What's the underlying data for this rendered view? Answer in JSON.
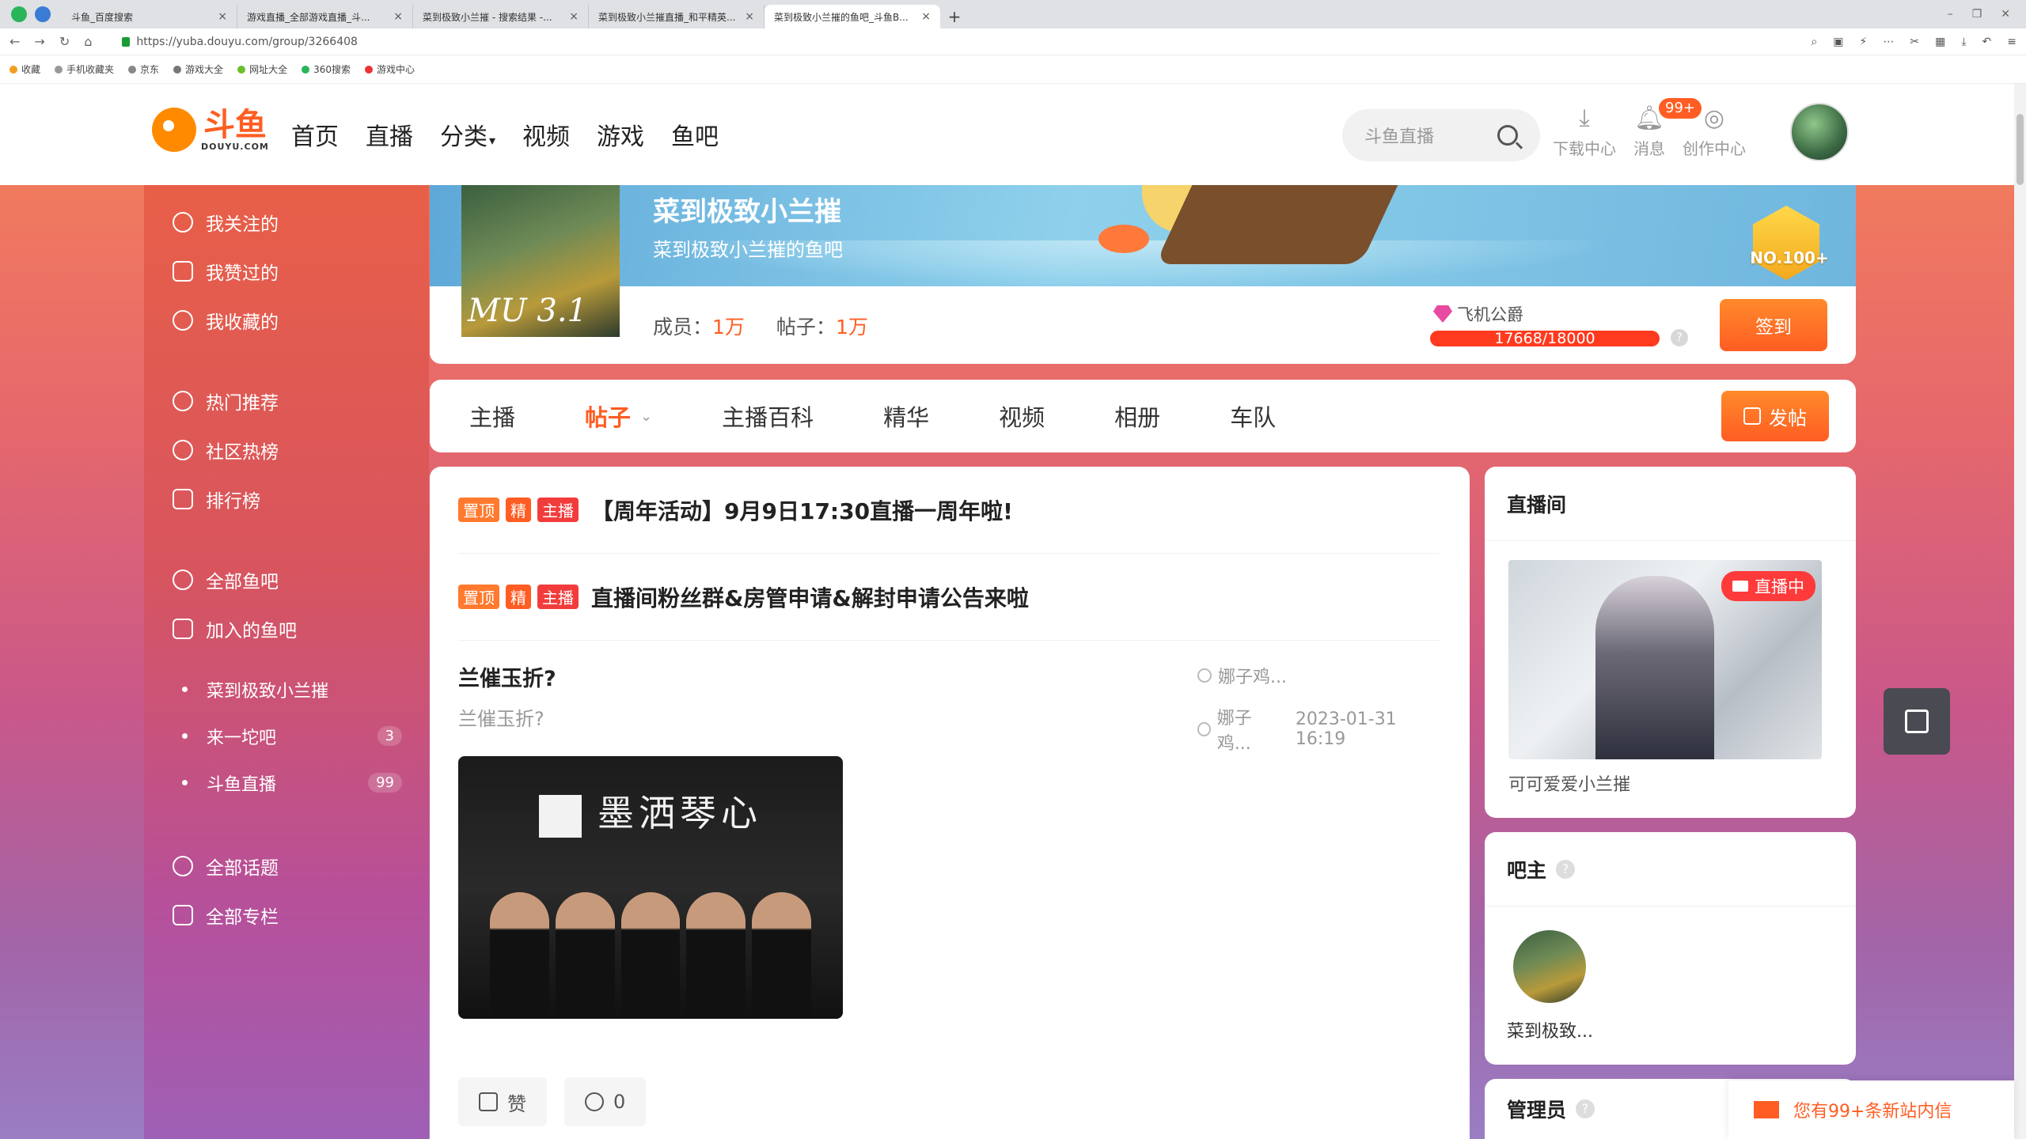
{
  "browser": {
    "tabs": [
      {
        "title": "斗鱼_百度搜索",
        "active": false
      },
      {
        "title": "游戏直播_全部游戏直播_斗...",
        "active": false
      },
      {
        "title": "菜到极致小兰摧 - 搜索结果 -...",
        "active": false
      },
      {
        "title": "菜到极致小兰摧直播_和平精英...",
        "active": false
      },
      {
        "title": "菜到极致小兰摧的鱼吧_斗鱼B...",
        "active": true
      }
    ],
    "new_tab": "+",
    "url": "https://yuba.douyu.com/group/3266408",
    "bookmarks": [
      "收藏",
      "手机收藏夹",
      "京东",
      "游戏大全",
      "网址大全",
      "360搜索",
      "游戏中心"
    ]
  },
  "header": {
    "logo_cn": "斗鱼",
    "logo_en": "DOUYU.COM",
    "nav": [
      "首页",
      "直播",
      "分类",
      "视频",
      "游戏",
      "鱼吧"
    ],
    "search_placeholder": "斗鱼直播",
    "download_label": "下载中心",
    "messages_label": "消息",
    "messages_badge": "99+",
    "creator_label": "创作中心"
  },
  "sidebar": {
    "group1": [
      "我关注的",
      "我赞过的",
      "我收藏的"
    ],
    "group2": [
      "热门推荐",
      "社区热榜",
      "排行榜"
    ],
    "group3": [
      "全部鱼吧",
      "加入的鱼吧"
    ],
    "joined": [
      {
        "name": "菜到极致小兰摧",
        "count": ""
      },
      {
        "name": "来一坨吧",
        "count": "3"
      },
      {
        "name": "斗鱼直播",
        "count": "99"
      }
    ],
    "group4": [
      "全部话题",
      "全部专栏"
    ]
  },
  "group": {
    "name": "菜到极致小兰摧",
    "subtitle": "菜到极致小兰摧的鱼吧",
    "avatar_text": "MU 3.1",
    "rank": "NO.100+",
    "members_label": "成员：",
    "members_value": "1万",
    "posts_label": "帖子：",
    "posts_value": "1万",
    "level_name": "飞机公爵",
    "level_progress": "17668/18000",
    "level_fraction": 0.9816,
    "signin_label": "签到"
  },
  "tabs": {
    "items": [
      "主播",
      "帖子",
      "主播百科",
      "精华",
      "视频",
      "相册",
      "车队"
    ],
    "active": "帖子",
    "post_label": "发帖"
  },
  "feed": {
    "pinned": [
      {
        "tags": [
          "置顶",
          "精",
          "主播"
        ],
        "title": "【周年活动】9月9日17:30直播一周年啦!"
      },
      {
        "tags": [
          "置顶",
          "精",
          "主播"
        ],
        "title": "直播间粉丝群&房管申请&解封申请公告来啦"
      }
    ],
    "post": {
      "title": "兰催玉折?",
      "desc": "兰催玉折?",
      "author": "娜子鸡...",
      "last_reply_user": "娜子鸡...",
      "time": "2023-01-31 16:19",
      "image_text": "墨洒琴心",
      "like_label": "赞",
      "comment_count": "0"
    }
  },
  "right": {
    "live_title": "直播间",
    "live_badge": "直播中",
    "live_name": "可可爱爱小兰摧",
    "owner_title": "吧主",
    "owner_name": "菜到极致...",
    "admin_title": "管理员"
  },
  "notify": {
    "text": "您有99+条新站内信"
  },
  "colors": {
    "brand": "#ff5d23",
    "sidebar_top": "#e85f48",
    "sidebar_bottom": "#9e5fb5"
  }
}
